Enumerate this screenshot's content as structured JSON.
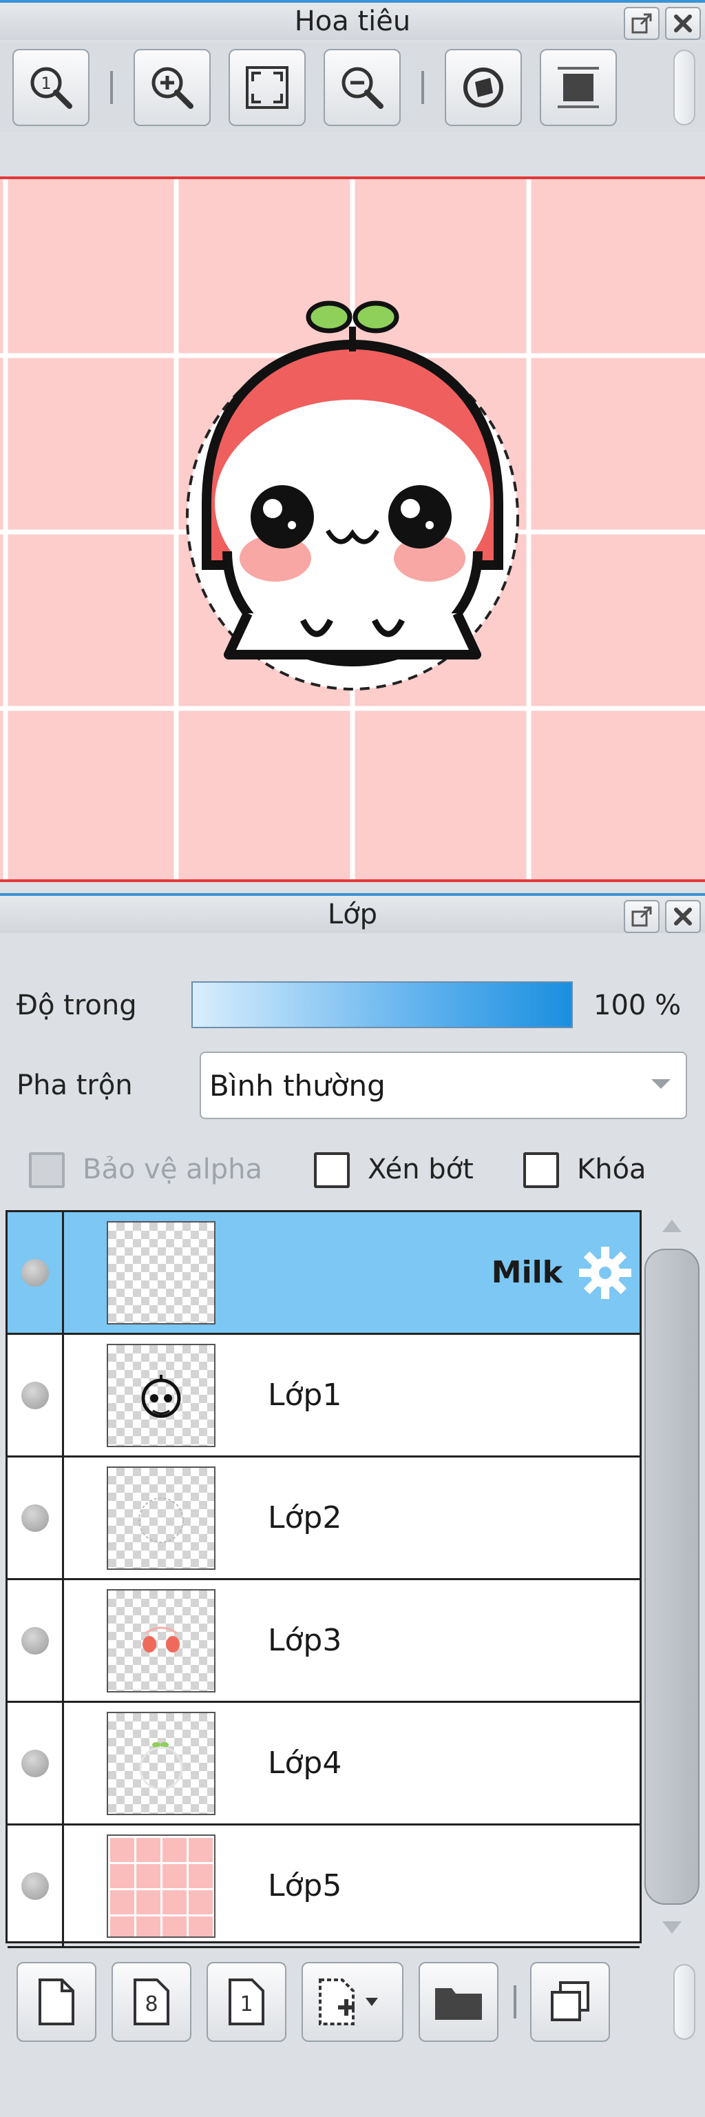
{
  "navigator": {
    "title": "Hoa tiêu",
    "tools": [
      "actual-size-icon",
      "zoom-in-icon",
      "fit-screen-icon",
      "zoom-out-icon",
      "rotate-reset-icon",
      "flip-icon"
    ]
  },
  "layers_panel": {
    "title": "Lớp",
    "opacity_label": "Độ trong",
    "opacity_value": "100 %",
    "opacity_fraction": 1.0,
    "blend_label": "Pha trộn",
    "blend_value": "Bình thường",
    "protect_alpha_label": "Bảo vệ alpha",
    "clipping_label": "Xén bớt",
    "lock_label": "Khóa",
    "layers": [
      {
        "name": "Milk",
        "selected": true,
        "thumb": "blank"
      },
      {
        "name": "Lớp1",
        "selected": false,
        "thumb": "face"
      },
      {
        "name": "Lớp2",
        "selected": false,
        "thumb": "outline"
      },
      {
        "name": "Lớp3",
        "selected": false,
        "thumb": "cheeks"
      },
      {
        "name": "Lớp4",
        "selected": false,
        "thumb": "sprout"
      },
      {
        "name": "Lớp5",
        "selected": false,
        "thumb": "pinkgrid"
      }
    ],
    "bottom_tools": [
      "new-layer-icon",
      "8bit-layer-icon",
      "1bit-layer-icon",
      "add-layer-menu-icon",
      "folder-icon",
      "duplicate-icon"
    ],
    "tool_8bit": "8",
    "tool_1bit": "1"
  },
  "colors": {
    "accent_blue": "#3a93d6",
    "canvas_border": "#e23a3a",
    "selected_row": "#7cc7f3",
    "canvas_pink": "#fdcdcb"
  }
}
